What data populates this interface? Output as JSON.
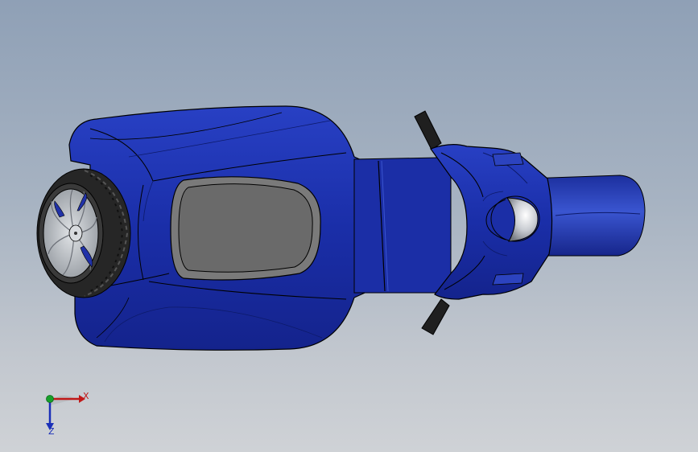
{
  "viewport": {
    "background_top": "#8fa0b6",
    "background_bottom": "#cfd2d6"
  },
  "model": {
    "body_color": "#1a2ea8",
    "body_highlight": "#3a55d0",
    "seat_color": "#6b6b6b",
    "tire_color": "#2a2a2a",
    "rim_color": "#b8bcc2",
    "edge_color": "#000000"
  },
  "triad": {
    "x_label": "X",
    "z_label": "Z",
    "x_color": "#c01818",
    "y_color": "#17a02a",
    "z_color": "#1a2fb8"
  }
}
